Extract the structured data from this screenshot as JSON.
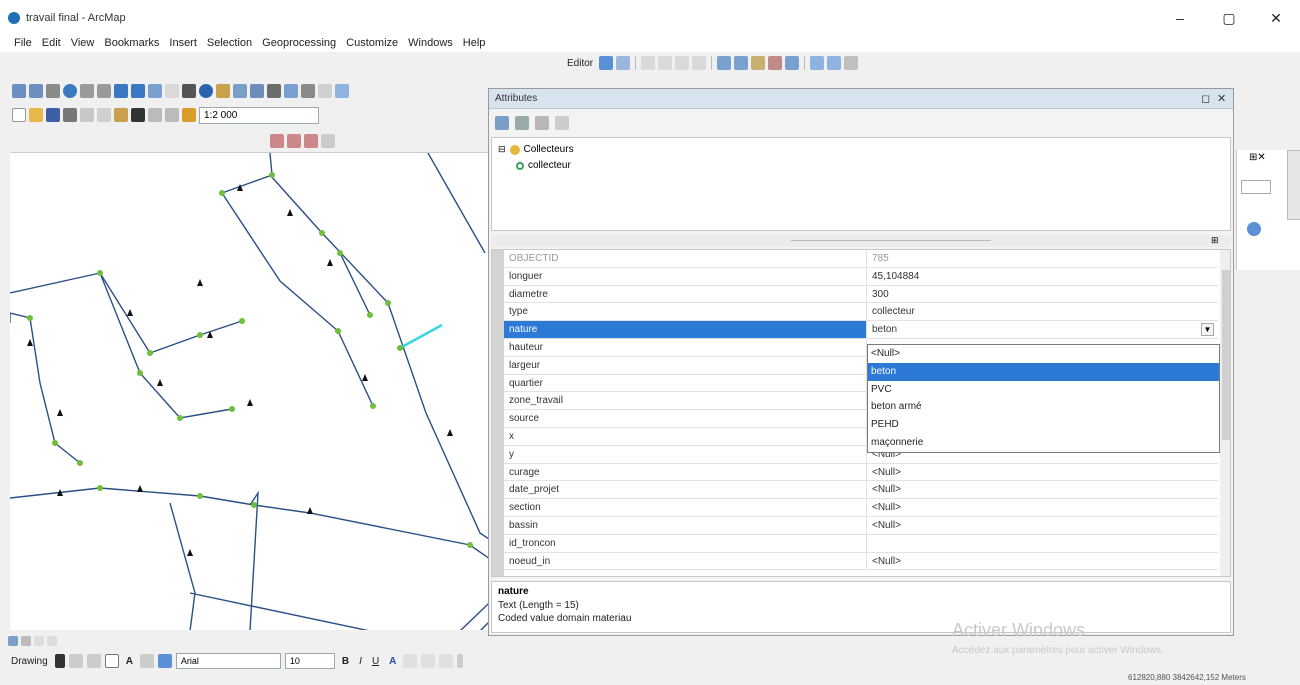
{
  "window": {
    "title": "travail final - ArcMap"
  },
  "menu": [
    "File",
    "Edit",
    "View",
    "Bookmarks",
    "Insert",
    "Selection",
    "Geoprocessing",
    "Customize",
    "Windows",
    "Help"
  ],
  "toolbar": {
    "editor_label": "Editor",
    "scale": "1:2 000"
  },
  "attributes": {
    "title": "Attributes",
    "layer": "Collecteurs",
    "feature": "collecteur",
    "rows": [
      {
        "name": "OBJECTID",
        "value": "785"
      },
      {
        "name": "longuer",
        "value": "45,104884"
      },
      {
        "name": "diametre",
        "value": "300"
      },
      {
        "name": "type",
        "value": "collecteur"
      },
      {
        "name": "nature",
        "value": "beton"
      },
      {
        "name": "hauteur",
        "value": ""
      },
      {
        "name": "largeur",
        "value": ""
      },
      {
        "name": "quartier",
        "value": ""
      },
      {
        "name": "zone_travail",
        "value": ""
      },
      {
        "name": "source",
        "value": ""
      },
      {
        "name": "x",
        "value": ""
      },
      {
        "name": "y",
        "value": "<Null>"
      },
      {
        "name": "curage",
        "value": "<Null>"
      },
      {
        "name": "date_projet",
        "value": "<Null>"
      },
      {
        "name": "section",
        "value": "<Null>"
      },
      {
        "name": "bassin",
        "value": "<Null>"
      },
      {
        "name": "id_troncon",
        "value": ""
      },
      {
        "name": "noeud_in",
        "value": "<Null>"
      }
    ],
    "dropdown_options": [
      "<Null>",
      "beton",
      "PVC",
      "beton armé",
      "PEHD",
      "maçonnerie"
    ],
    "selected_option": "beton",
    "description": {
      "field": "nature",
      "line1": "Text (Length = 15)",
      "line2": "Coded value domain materiau"
    }
  },
  "drawing": {
    "label": "Drawing",
    "font": "Arial",
    "size": "10"
  },
  "watermark": {
    "title": "Activer Windows",
    "subtitle": "Accédez aux paramètres pour activer Windows."
  },
  "status": {
    "coords": "612820,880 3842642,152 Meters"
  },
  "colors": {
    "selection": "#2d7ad6",
    "pipe": "#2b4f86",
    "node": "#6fbf3a",
    "selected_feature": "#38d6e0"
  }
}
